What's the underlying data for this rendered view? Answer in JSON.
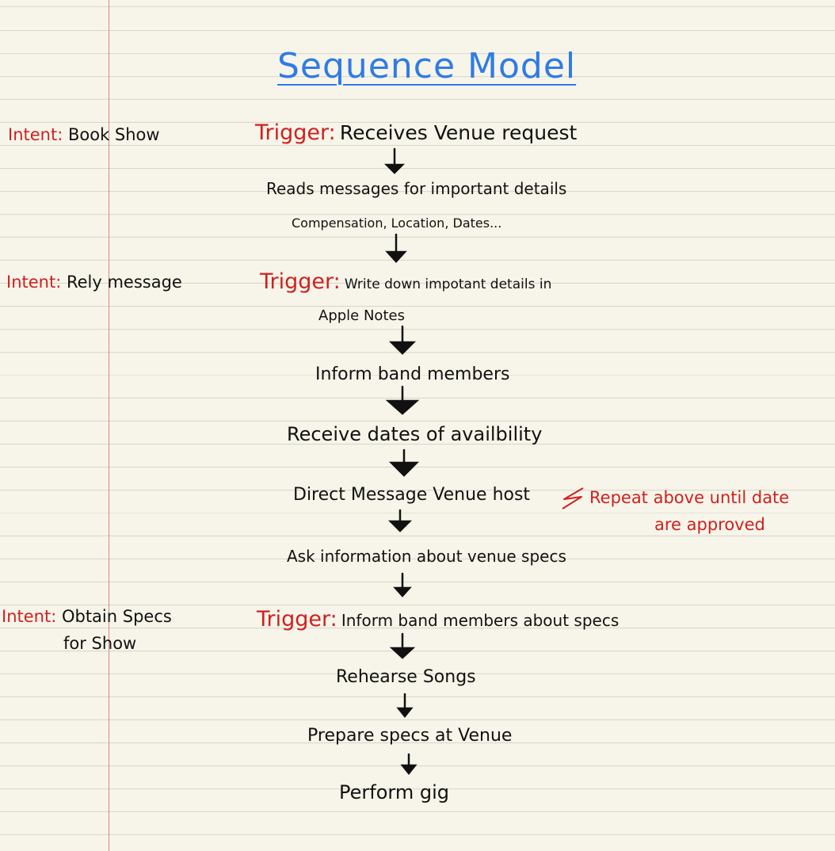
{
  "title": "Sequence Model",
  "colors": {
    "title": "#2f7be8",
    "intent_trigger": "#d02020",
    "ink": "#111111",
    "margin": "#d98585",
    "rule": "#d8d6cb"
  },
  "intents": [
    {
      "label": "Intent:",
      "text": "Book Show"
    },
    {
      "label": "Intent:",
      "text": "Rely message"
    },
    {
      "label": "Intent:",
      "text": "Obtain Specs",
      "text2": "for Show"
    }
  ],
  "flow": {
    "trigger1": {
      "label": "Trigger:",
      "text": "Receives Venue request"
    },
    "step_reads": "Reads messages for important details",
    "step_reads_detail": "Compensation, Location, Dates...",
    "trigger2": {
      "label": "Trigger:",
      "text": "Write down impotant details in",
      "text2": "Apple Notes"
    },
    "step_inform": "Inform band members",
    "step_receive": "Receive dates of availbility",
    "step_direct": "Direct Message Venue host",
    "note": {
      "line1": "Repeat above until date",
      "line2": "are approved"
    },
    "step_ask": "Ask information about venue specs",
    "trigger3": {
      "label": "Trigger:",
      "text": "Inform band members about specs"
    },
    "step_rehearse": "Rehearse Songs",
    "step_prepare": "Prepare specs at Venue",
    "step_perform": "Perform gig"
  }
}
